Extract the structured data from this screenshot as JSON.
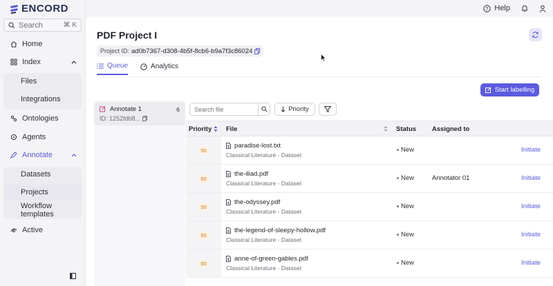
{
  "brand": {
    "logo_text": "ENCORD"
  },
  "search": {
    "label": "Search",
    "shortcut": "⌘ K"
  },
  "topbar": {
    "help_label": "Help"
  },
  "sidebar": {
    "items": [
      {
        "label": "Home"
      },
      {
        "label": "Index"
      },
      {
        "label": "Files"
      },
      {
        "label": "Integrations"
      },
      {
        "label": "Ontologies"
      },
      {
        "label": "Agents"
      },
      {
        "label": "Annotate"
      },
      {
        "label": "Datasets"
      },
      {
        "label": "Projects"
      },
      {
        "label": "Workflow templates"
      },
      {
        "label": "Active"
      }
    ]
  },
  "project": {
    "title": "PDF Project I",
    "id_label": "Project ID:",
    "id_value": "ad0b7367-d308-4b5f-8cb6-b9a7f3c86024"
  },
  "tabs": [
    {
      "label": "Queue"
    },
    {
      "label": "Analytics"
    }
  ],
  "actions": {
    "start_labelling": "Start labelling"
  },
  "stage": {
    "name": "Annotate 1",
    "count": "6",
    "id": "ID: 1252fdb8..."
  },
  "filters": {
    "search_placeholder": "Search file",
    "priority_label": "Priority"
  },
  "table": {
    "headers": {
      "priority": "Priority",
      "file": "File",
      "status": "Status",
      "assigned": "Assigned to"
    },
    "rows": [
      {
        "priority": "50",
        "file": "paradise-lost.txt",
        "dataset": "Classical Literature - Dataset",
        "status": "New",
        "assignee": "",
        "action": "Initiate"
      },
      {
        "priority": "50",
        "file": "the-iliad.pdf",
        "dataset": "Classical Literature - Dataset",
        "status": "New",
        "assignee": "Annotator 01",
        "action": "Initiate"
      },
      {
        "priority": "50",
        "file": "the-odyssey.pdf",
        "dataset": "Classical Literature - Dataset",
        "status": "New",
        "assignee": "",
        "action": "Initiate"
      },
      {
        "priority": "50",
        "file": "the-legend-of-sleepy-hollow.pdf",
        "dataset": "Classical Literature - Dataset",
        "status": "New",
        "assignee": "",
        "action": "Initiate"
      },
      {
        "priority": "50",
        "file": "anne-of-green-gables.pdf",
        "dataset": "Classical Literature - Dataset",
        "status": "New",
        "assignee": "",
        "action": "Initiate"
      }
    ]
  },
  "colors": {
    "accent": "#5b5be0",
    "priority_badge": "#c4761a"
  }
}
